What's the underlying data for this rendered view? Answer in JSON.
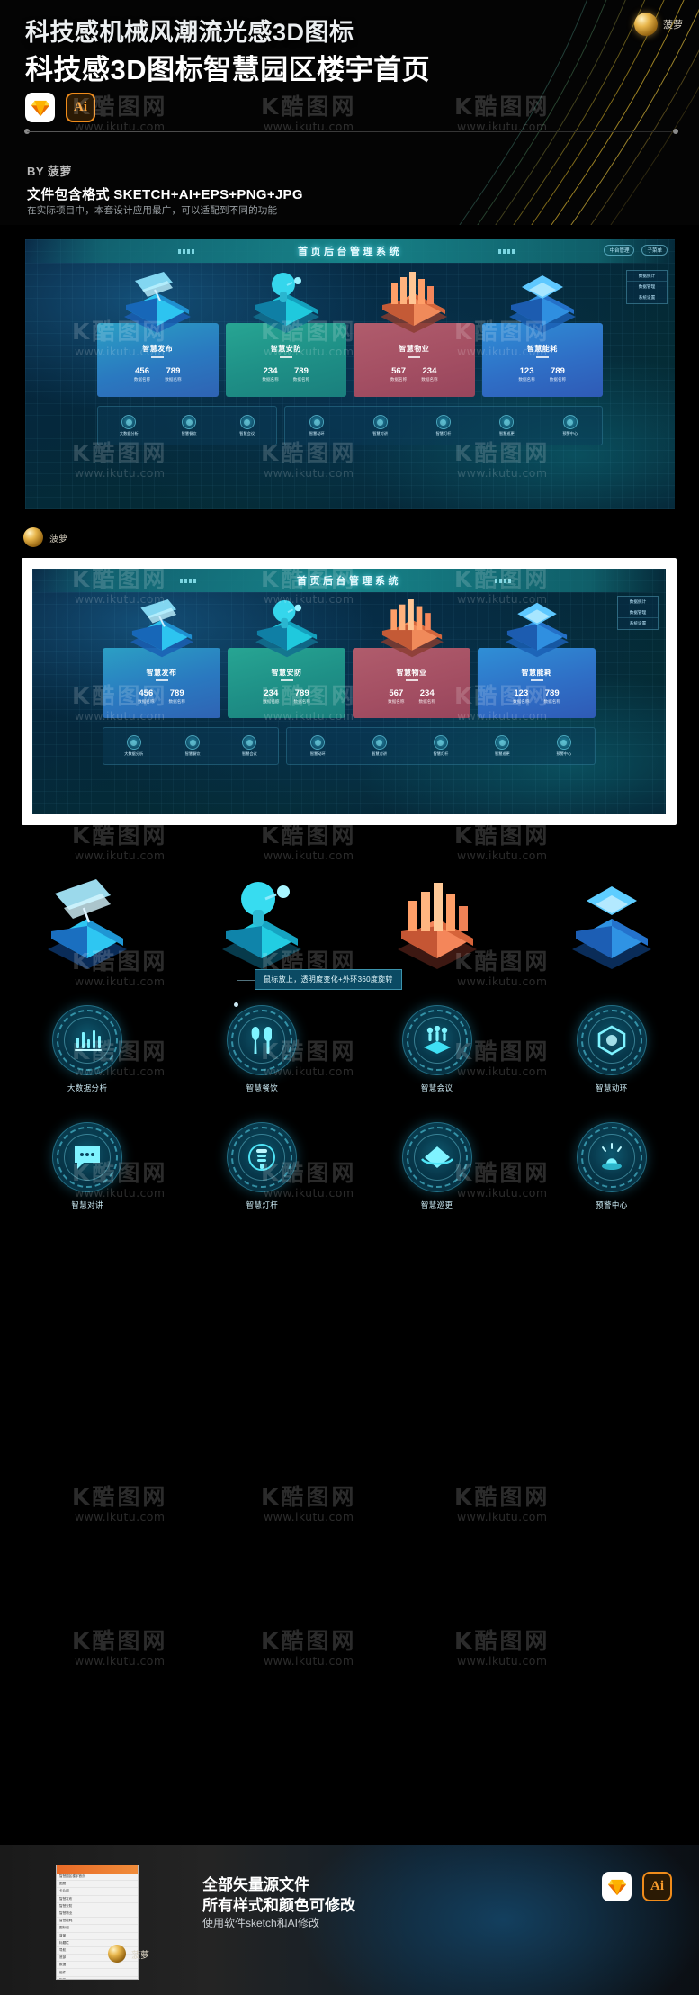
{
  "hero": {
    "title_line1": "科技感机械风潮流光感3D图标",
    "title_line2": "科技感3D图标智慧园区楼宇首页",
    "author_name": "菠萝",
    "app_logo_ai": "Ai",
    "by_line": "BY 菠萝",
    "format_line": "文件包含格式  SKETCH+AI+EPS+PNG+JPG",
    "desc_line": "在实际项目中，本套设计应用最广，可以适配到不同的功能"
  },
  "watermark": {
    "brand": "K酷图网",
    "url": "www.ikutu.com"
  },
  "dashboard": {
    "title": "首页后台管理系统",
    "header_right": [
      "中台管理",
      "子菜单"
    ],
    "side_panel": [
      "数据统计",
      "数据管理",
      "系统设置"
    ],
    "cards": [
      {
        "name": "智慧发布",
        "stat1_num": "456",
        "stat1_label": "数据名称",
        "stat2_num": "789",
        "stat2_label": "数据名称"
      },
      {
        "name": "智慧安防",
        "stat1_num": "234",
        "stat1_label": "数据名称",
        "stat2_num": "789",
        "stat2_label": "数据名称"
      },
      {
        "name": "智慧物业",
        "stat1_num": "567",
        "stat1_label": "数据名称",
        "stat2_num": "234",
        "stat2_label": "数据名称"
      },
      {
        "name": "智慧能耗",
        "stat1_num": "123",
        "stat1_label": "数据名称",
        "stat2_num": "789",
        "stat2_label": "数据名称"
      }
    ],
    "strip_left": [
      "大数据分析",
      "智慧餐饮",
      "智慧会议"
    ],
    "strip_right": [
      "智慧动环",
      "智慧对讲",
      "智慧灯杆",
      "智慧巡更",
      "预警中心"
    ]
  },
  "tooltip": {
    "text": "鼠标放上，透明度变化+外环360度旋转"
  },
  "icon_grid": {
    "row1": [
      {
        "label": "大数据分析",
        "icon": "bar-chart-icon"
      },
      {
        "label": "智慧餐饮",
        "icon": "fork-spoon-icon"
      },
      {
        "label": "智慧会议",
        "icon": "meeting-icon"
      },
      {
        "label": "智慧动环",
        "icon": "hexagon-icon"
      }
    ],
    "row2": [
      {
        "label": "智慧对讲",
        "icon": "chat-bubble-icon"
      },
      {
        "label": "智慧灯杆",
        "icon": "lamp-post-icon"
      },
      {
        "label": "智慧巡更",
        "icon": "patrol-icon"
      },
      {
        "label": "预警中心",
        "icon": "alarm-icon"
      }
    ]
  },
  "big_icons": [
    {
      "name": "智慧发布",
      "color": "#1e90d8"
    },
    {
      "name": "智慧安防",
      "color": "#16b9d8"
    },
    {
      "name": "智慧物业",
      "color": "#e86a46"
    },
    {
      "name": "智慧能耗",
      "color": "#2a8fe0"
    }
  ],
  "footer": {
    "title1": "全部矢量源文件",
    "title2": "所有样式和颜色可修改",
    "subtitle": "使用软件sketch和AI修改",
    "author_name": "菠萝",
    "ai_label": "Ai",
    "tree_rows": [
      "智慧园区楼宇首页",
      "图层",
      "卡片组",
      "智慧发布",
      "智慧安防",
      "智慧物业",
      "智慧能耗",
      "图标组",
      "背景",
      "标题栏",
      "导航",
      "底部",
      "数据",
      "组件",
      "矩形",
      "文本"
    ]
  },
  "colors": {
    "accent_cyan": "#4ddbf0",
    "accent_orange": "#f08c1b",
    "card_blue": "#2a79c0",
    "card_teal": "#1e8f86",
    "card_rose": "#a44f63"
  }
}
